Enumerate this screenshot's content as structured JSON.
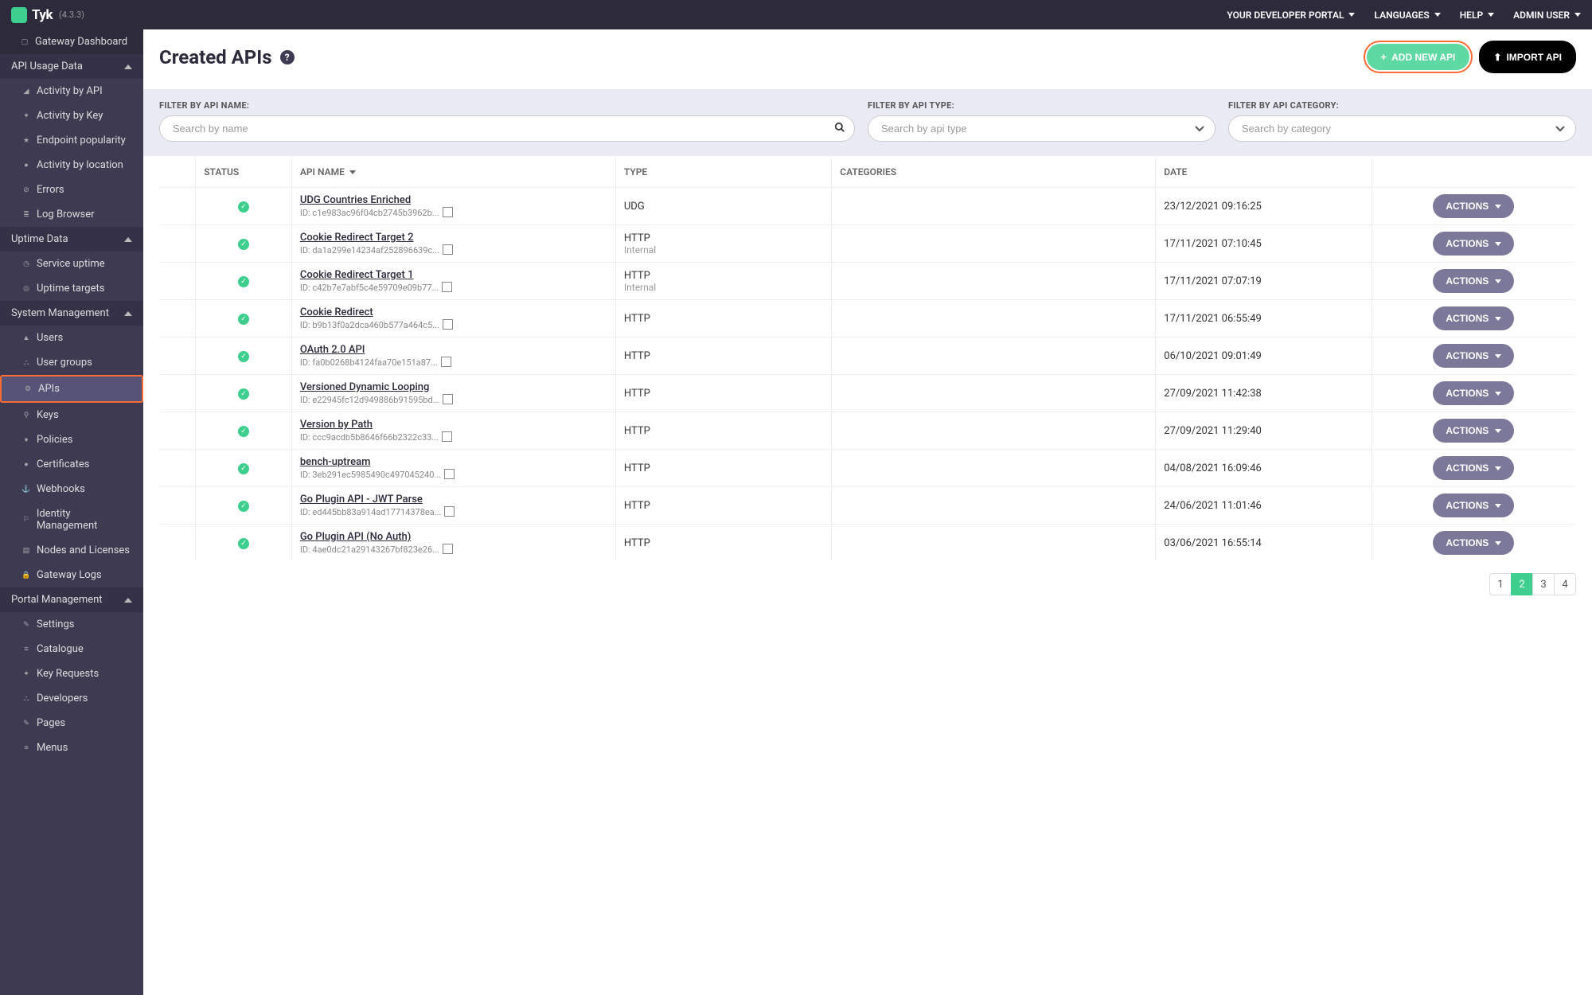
{
  "app": {
    "name": "Tyk",
    "version": "(4.3.3)"
  },
  "topbar": {
    "portal": "YOUR DEVELOPER PORTAL",
    "languages": "LANGUAGES",
    "help": "HELP",
    "user": "ADMIN USER"
  },
  "sidebar": {
    "gateway_dashboard": "Gateway Dashboard",
    "api_usage_data": "API Usage Data",
    "activity_api": "Activity by API",
    "activity_key": "Activity by Key",
    "endpoint_popularity": "Endpoint popularity",
    "activity_location": "Activity by location",
    "errors": "Errors",
    "log_browser": "Log Browser",
    "uptime_data": "Uptime Data",
    "service_uptime": "Service uptime",
    "uptime_targets": "Uptime targets",
    "system_management": "System Management",
    "users": "Users",
    "user_groups": "User groups",
    "apis": "APIs",
    "keys": "Keys",
    "policies": "Policies",
    "certificates": "Certificates",
    "webhooks": "Webhooks",
    "identity_management": "Identity Management",
    "nodes_licenses": "Nodes and Licenses",
    "gateway_logs": "Gateway Logs",
    "portal_management": "Portal Management",
    "settings": "Settings",
    "catalogue": "Catalogue",
    "key_requests": "Key Requests",
    "developers": "Developers",
    "pages": "Pages",
    "menus": "Menus"
  },
  "page": {
    "title": "Created APIs",
    "add_new": "ADD NEW API",
    "import": "IMPORT API"
  },
  "filters": {
    "name_label": "FILTER BY API NAME:",
    "name_placeholder": "Search by name",
    "type_label": "FILTER BY API TYPE:",
    "type_placeholder": "Search by api type",
    "category_label": "FILTER BY API CATEGORY:",
    "category_placeholder": "Search by category"
  },
  "columns": {
    "status": "STATUS",
    "api_name": "API NAME",
    "type": "TYPE",
    "categories": "CATEGORIES",
    "date": "DATE"
  },
  "actions_label": "ACTIONS",
  "id_prefix": "ID: ",
  "rows": [
    {
      "name": "UDG Countries Enriched",
      "id": "c1e983ac96f04cb2745b3962b...",
      "type": "UDG",
      "subtype": "",
      "date": "23/12/2021 09:16:25"
    },
    {
      "name": "Cookie Redirect Target 2",
      "id": "da1a299e14234af252896639c...",
      "type": "HTTP",
      "subtype": "Internal",
      "date": "17/11/2021 07:10:45"
    },
    {
      "name": "Cookie Redirect Target 1",
      "id": "c42b7e7abf5c4e59709e09b77...",
      "type": "HTTP",
      "subtype": "Internal",
      "date": "17/11/2021 07:07:19"
    },
    {
      "name": "Cookie Redirect",
      "id": "b9b13f0a2dca460b577a464c5...",
      "type": "HTTP",
      "subtype": "",
      "date": "17/11/2021 06:55:49"
    },
    {
      "name": "OAuth 2.0 API",
      "id": "fa0b0268b4124faa70e151a87...",
      "type": "HTTP",
      "subtype": "",
      "date": "06/10/2021 09:01:49"
    },
    {
      "name": "Versioned Dynamic Looping",
      "id": "e22945fc12d949886b91595bd...",
      "type": "HTTP",
      "subtype": "",
      "date": "27/09/2021 11:42:38"
    },
    {
      "name": "Version by Path",
      "id": "ccc9acdb5b8646f66b2322c33...",
      "type": "HTTP",
      "subtype": "",
      "date": "27/09/2021 11:29:40"
    },
    {
      "name": "bench-uptream",
      "id": "3eb291ec5985490c497045240...",
      "type": "HTTP",
      "subtype": "",
      "date": "04/08/2021 16:09:46"
    },
    {
      "name": "Go Plugin API - JWT Parse",
      "id": "ed445bb83a914ad17714378ea...",
      "type": "HTTP",
      "subtype": "",
      "date": "24/06/2021 11:01:46"
    },
    {
      "name": "Go Plugin API (No Auth)",
      "id": "4ae0dc21a29143267bf823e26...",
      "type": "HTTP",
      "subtype": "",
      "date": "03/06/2021 16:55:14"
    }
  ],
  "pagination": {
    "pages": [
      "1",
      "2",
      "3",
      "4"
    ],
    "active": "2"
  }
}
